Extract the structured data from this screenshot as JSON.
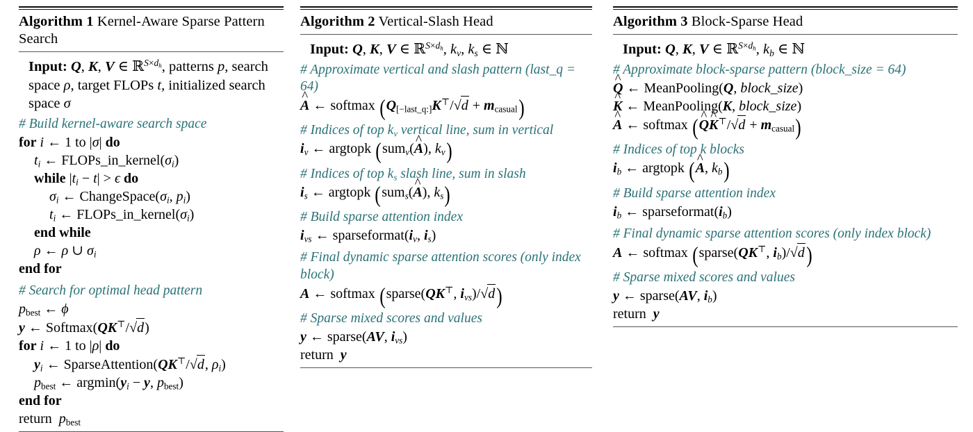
{
  "figure": {
    "type": "algorithm-listing",
    "accent_comment_color": "#2b7277",
    "rule_color": "#555555",
    "background": "#ffffff",
    "columns": 3
  },
  "algorithms": [
    {
      "number": "Algorithm 1",
      "name": "Kernel-Aware Sparse Pattern Search",
      "input_label": "Input:",
      "input_body": "Q, K, V ∈ ℝ^{S×d_h}, patterns p, search space ρ, target FLOPs t, initialized search space σ",
      "lines": [
        {
          "kind": "comment",
          "text": "# Build kernel-aware search space",
          "indent": 0
        },
        {
          "kind": "code",
          "text": "for i ← 1 to |σ| do",
          "indent": 0
        },
        {
          "kind": "code",
          "text": "t_i ← FLOPs_in_kernel(σ_i)",
          "indent": 1
        },
        {
          "kind": "code",
          "text": "while |t_i − t| > ϵ do",
          "indent": 1
        },
        {
          "kind": "code",
          "text": "σ_i ← ChangeSpace(σ_i, p_i)",
          "indent": 2
        },
        {
          "kind": "code",
          "text": "t_i ← FLOPs_in_kernel(σ_i)",
          "indent": 2
        },
        {
          "kind": "code",
          "text": "end while",
          "indent": 1
        },
        {
          "kind": "code",
          "text": "ρ ← ρ ∪ σ_i",
          "indent": 1
        },
        {
          "kind": "code",
          "text": "end for",
          "indent": 0
        },
        {
          "kind": "comment",
          "text": "# Search for optimal head pattern",
          "indent": 0
        },
        {
          "kind": "code",
          "text": "p_best ← ϕ",
          "indent": 0
        },
        {
          "kind": "code",
          "text": "y ← Softmax(QK^⊤/√d)",
          "indent": 0
        },
        {
          "kind": "code",
          "text": "for i ← 1 to |ρ| do",
          "indent": 0
        },
        {
          "kind": "code",
          "text": "y_i ← SparseAttention(QK^⊤/√d, ρ_i)",
          "indent": 1
        },
        {
          "kind": "code",
          "text": "p_best ← argmin(y_i − y, p_best)",
          "indent": 1
        },
        {
          "kind": "code",
          "text": "end for",
          "indent": 0
        },
        {
          "kind": "code",
          "text": "return p_best",
          "indent": 0
        }
      ]
    },
    {
      "number": "Algorithm 2",
      "name": "Vertical-Slash Head",
      "input_label": "Input:",
      "input_body": "Q, K, V ∈ ℝ^{S×d_h}, k_v, k_s ∈ ℕ",
      "lines": [
        {
          "kind": "comment",
          "text": "# Approximate vertical and slash pattern (last_q = 64)",
          "indent": 0
        },
        {
          "kind": "code",
          "text": "Â ← softmax( Q_[−last_q:] K^⊤/√d + m_casual )",
          "indent": 0
        },
        {
          "kind": "comment",
          "text": "# Indices of top k_v vertical line, sum in vertical",
          "indent": 0
        },
        {
          "kind": "code",
          "text": "i_v ← argtopk( sum_v(Â), k_v )",
          "indent": 0
        },
        {
          "kind": "comment",
          "text": "# Indices of top k_s slash line, sum in slash",
          "indent": 0
        },
        {
          "kind": "code",
          "text": "i_s ← argtopk( sum_s(Â), k_s )",
          "indent": 0
        },
        {
          "kind": "comment",
          "text": "# Build sparse attention index",
          "indent": 0
        },
        {
          "kind": "code",
          "text": "i_vs ← sparseformat(i_v, i_s)",
          "indent": 0
        },
        {
          "kind": "comment",
          "text": "# Final dynamic sparse attention scores (only index block)",
          "indent": 0
        },
        {
          "kind": "code",
          "text": "A ← softmax( sparse(QK^⊤, i_vs)/√d )",
          "indent": 0
        },
        {
          "kind": "comment",
          "text": "# Sparse mixed scores and values",
          "indent": 0
        },
        {
          "kind": "code",
          "text": "y ← sparse(AV, i_vs)",
          "indent": 0
        },
        {
          "kind": "code",
          "text": "return y",
          "indent": 0
        }
      ]
    },
    {
      "number": "Algorithm 3",
      "name": "Block-Sparse Head",
      "input_label": "Input:",
      "input_body": "Q, K, V ∈ ℝ^{S×d_h}, k_b ∈ ℕ",
      "lines": [
        {
          "kind": "comment",
          "text": "# Approximate block-sparse pattern (block_size = 64)",
          "indent": 0
        },
        {
          "kind": "code",
          "text": "Q̂ ← MeanPooling(Q, block_size)",
          "indent": 0
        },
        {
          "kind": "code",
          "text": "K̂ ← MeanPooling(K, block_size)",
          "indent": 0
        },
        {
          "kind": "code",
          "text": "Â ← softmax( Q̂K̂^⊤/√d + m_casual )",
          "indent": 0
        },
        {
          "kind": "comment",
          "text": "# Indices of top k blocks",
          "indent": 0
        },
        {
          "kind": "code",
          "text": "i_b ← argtopk( Â, k_b )",
          "indent": 0
        },
        {
          "kind": "comment",
          "text": "# Build sparse attention index",
          "indent": 0
        },
        {
          "kind": "code",
          "text": "i_b ← sparseformat(i_b)",
          "indent": 0
        },
        {
          "kind": "comment",
          "text": "# Final dynamic sparse attention scores (only index block)",
          "indent": 0
        },
        {
          "kind": "code",
          "text": "A ← softmax( sparse(QK^⊤, i_b)/√d )",
          "indent": 0
        },
        {
          "kind": "comment",
          "text": "# Sparse mixed scores and values",
          "indent": 0
        },
        {
          "kind": "code",
          "text": "y ← sparse(AV, i_b)",
          "indent": 0
        },
        {
          "kind": "code",
          "text": "return y",
          "indent": 0
        }
      ]
    }
  ]
}
